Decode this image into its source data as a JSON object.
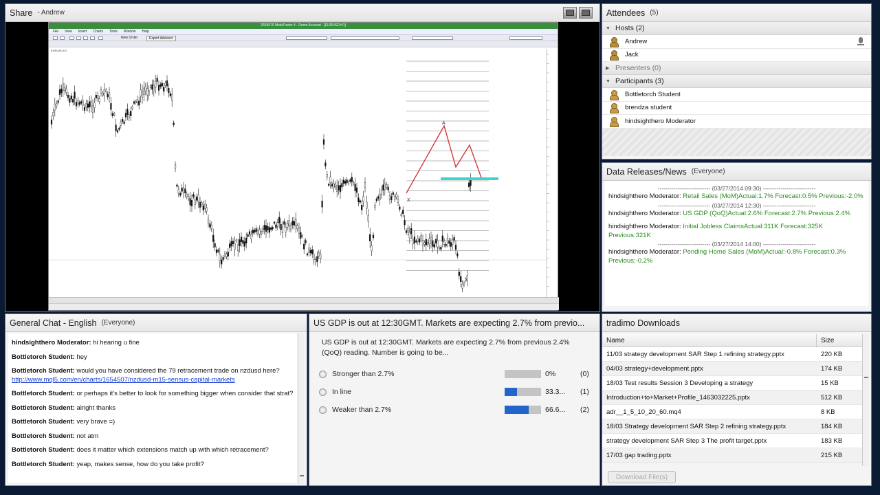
{
  "share": {
    "title": "Share",
    "presenter": "- Andrew"
  },
  "attendees": {
    "title": "Attendees",
    "count": "(5)",
    "groups": {
      "hosts": "Hosts (2)",
      "presenters": "Presenters (0)",
      "participants": "Participants (3)"
    },
    "hosts": [
      "Andrew",
      "Jack"
    ],
    "participants": [
      "Bottletorch Student",
      "brendza student",
      "hindsighthero Moderator"
    ]
  },
  "data_releases": {
    "title": "Data Releases/News",
    "scope": "(Everyone)",
    "entries": [
      {
        "sep": "--------------------------- (03/27/2014 09:30) ---------------------------",
        "author": "hindsighthero Moderator:",
        "text": "Retail Sales (MoM)Actual:1.7% Forecast:0.5% Previous:-2.0%"
      },
      {
        "sep": "--------------------------- (03/27/2014 12:30) ---------------------------",
        "author": "hindsighthero Moderator:",
        "text": "US GDP (QoQ)Actual:2.6% Forecast:2.7% Previous:2.4%"
      },
      {
        "sep": "",
        "author": "hindsighthero Moderator:",
        "text": "Initial Jobless ClaimsActual:311K Forecast:325K Previous:321K"
      },
      {
        "sep": "--------------------------- (03/27/2014 14:00) ---------------------------",
        "author": "hindsighthero Moderator:",
        "text": "Pending Home Sales (MoM)Actual:-0.8% Forecast:0.3% Previous:-0.2%"
      }
    ]
  },
  "chat": {
    "title": "General Chat - English",
    "scope": "(Everyone)",
    "messages": [
      {
        "author": "hindsighthero Moderator:",
        "text": "hi hearing u fine"
      },
      {
        "author": "Bottletorch Student:",
        "text": "hey"
      },
      {
        "author": "Bottletorch Student:",
        "text": "would you have considered the 79 retracement trade on nzdusd here?",
        "link": "http://www.mql5.com/en/charts/1654507/nzdusd-m15-sensus-capital-markets"
      },
      {
        "author": "Bottletorch Student:",
        "text": "or perhaps it's better to look for something bigger when consider that strat?"
      },
      {
        "author": "Bottletorch Student:",
        "text": "alright thanks"
      },
      {
        "author": "Bottletorch Student:",
        "text": "very brave =)"
      },
      {
        "author": "Bottletorch Student:",
        "text": "not atm"
      },
      {
        "author": "Bottletorch Student:",
        "text": "does it matter which extensions match up with which retracement?"
      },
      {
        "author": "Bottletorch Student:",
        "text": "yeap, makes sense, how do you take profit?"
      }
    ]
  },
  "poll": {
    "title": "US GDP is out at 12:30GMT. Markets are expecting 2.7% from previo...",
    "question": "US GDP is out at 12:30GMT. Markets are expecting 2.7% from previous 2.4% (QoQ) reading. Number is going to be...",
    "options": [
      {
        "label": "Stronger than 2.7%",
        "percent": "0%",
        "count": "(0)",
        "fraction": 0
      },
      {
        "label": "In line",
        "percent": "33.3...",
        "count": "(1)",
        "fraction": 0.333
      },
      {
        "label": "Weaker than 2.7%",
        "percent": "66.6...",
        "count": "(2)",
        "fraction": 0.666
      }
    ]
  },
  "downloads": {
    "title": "tradimo Downloads",
    "columns": {
      "name": "Name",
      "size": "Size"
    },
    "files": [
      {
        "name": "11/03 strategy development SAR Step 1 refining strategy.pptx",
        "size": "220 KB"
      },
      {
        "name": "04/03 strategy+development.pptx",
        "size": "174 KB"
      },
      {
        "name": "18/03 Test results Session 3 Developing a strategy",
        "size": "15 KB"
      },
      {
        "name": "Introduction+to+Market+Profile_1463032225.pptx",
        "size": "512 KB"
      },
      {
        "name": "adr__1_5_10_20_60.mq4",
        "size": "8 KB"
      },
      {
        "name": " 18/03 Strategy development SAR Step 2 refining strategy.pptx",
        "size": "184 KB"
      },
      {
        "name": "strategy development SAR Step 3 The profit target.pptx",
        "size": "183 KB"
      },
      {
        "name": "17/03 gap trading.pptx",
        "size": "215 KB"
      }
    ],
    "button": "Download File(s)"
  },
  "colors": {
    "background": "#0b1a33",
    "news_text": "#2b8a1f",
    "poll_bar": "#2266cc",
    "chart_zigzag": "#d23a3a",
    "chart_highlight": "#39d6d0"
  },
  "metatrader": {
    "title": "2669970 MetaTrader 4 - Demo Account - [EURUSD,H1]",
    "menu": [
      "File",
      "View",
      "Insert",
      "Charts",
      "Tools",
      "Window",
      "Help"
    ],
    "new_order": "New Order",
    "expert": "Expert Advisors",
    "symbol": "EURUSD,H1",
    "labels": {
      "a": "A",
      "x": "X"
    }
  }
}
